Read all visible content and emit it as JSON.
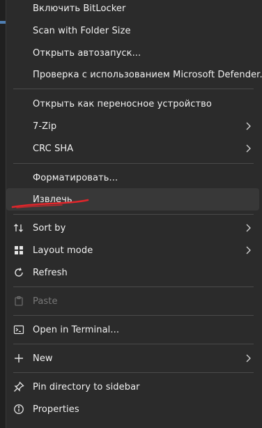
{
  "menu": {
    "items": [
      {
        "label": "Включить BitLocker"
      },
      {
        "label": "Scan with Folder Size"
      },
      {
        "label": "Открыть автозапуск..."
      },
      {
        "label": "Проверка с использованием Microsoft Defender..."
      },
      {
        "label": "Открыть как переносное устройство"
      },
      {
        "label": "7-Zip",
        "submenu": true
      },
      {
        "label": "CRC SHA",
        "submenu": true
      },
      {
        "label": "Форматировать..."
      },
      {
        "label": "Извлечь",
        "hovered": true
      },
      {
        "label": "Sort by",
        "icon": "sort-icon",
        "submenu": true
      },
      {
        "label": "Layout mode",
        "icon": "layout-icon",
        "submenu": true
      },
      {
        "label": "Refresh",
        "icon": "refresh-icon"
      },
      {
        "label": "Paste",
        "icon": "paste-icon",
        "disabled": true
      },
      {
        "label": "Open in Terminal...",
        "icon": "terminal-icon"
      },
      {
        "label": "New",
        "icon": "new-icon",
        "submenu": true
      },
      {
        "label": "Pin directory to sidebar",
        "icon": "pin-icon"
      },
      {
        "label": "Properties",
        "icon": "properties-icon"
      }
    ]
  },
  "colors": {
    "menu_bg": "#2b2b2b",
    "hover_bg": "#383838",
    "separator": "#4a4a4a",
    "annotation_red": "#e0262b",
    "disabled_text": "#787878"
  }
}
